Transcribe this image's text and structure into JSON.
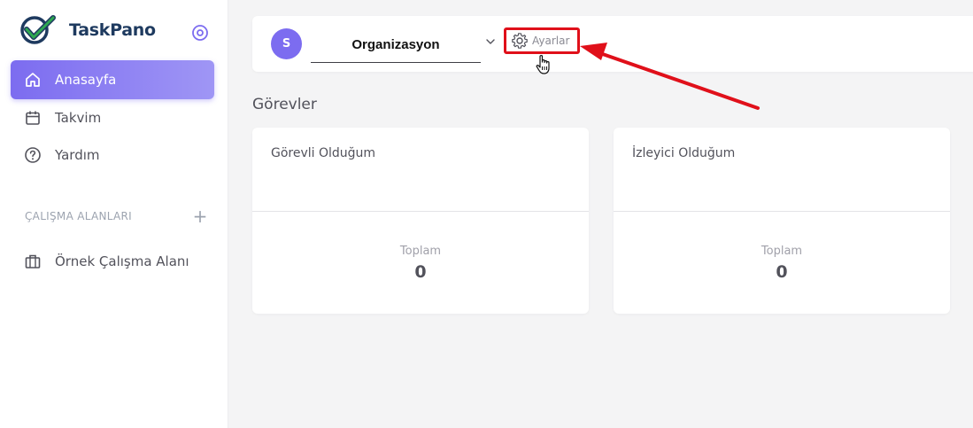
{
  "app": {
    "brand": "TaskPano",
    "accent_color": "#7c6cf0"
  },
  "sidebar": {
    "items": [
      {
        "label": "Anasayfa",
        "icon": "home-icon",
        "active": true
      },
      {
        "label": "Takvim",
        "icon": "calendar-icon",
        "active": false
      },
      {
        "label": "Yardım",
        "icon": "help-icon",
        "active": false
      }
    ],
    "workspaces_title": "ÇALIŞMA ALANLARI",
    "workspaces_add": "+",
    "workspaces": [
      {
        "label": "Örnek Çalışma Alanı",
        "icon": "briefcase-icon"
      }
    ]
  },
  "topbar": {
    "avatar_initial": "S",
    "organization": "Organizasyon",
    "settings_label": "Ayarlar"
  },
  "main": {
    "title": "Görevler",
    "cards": [
      {
        "title": "Görevli Olduğum",
        "total_label": "Toplam",
        "total_value": "0"
      },
      {
        "title": "İzleyici Olduğum",
        "total_label": "Toplam",
        "total_value": "0"
      }
    ]
  },
  "annotation": {
    "highlight_color": "#e0101a"
  }
}
